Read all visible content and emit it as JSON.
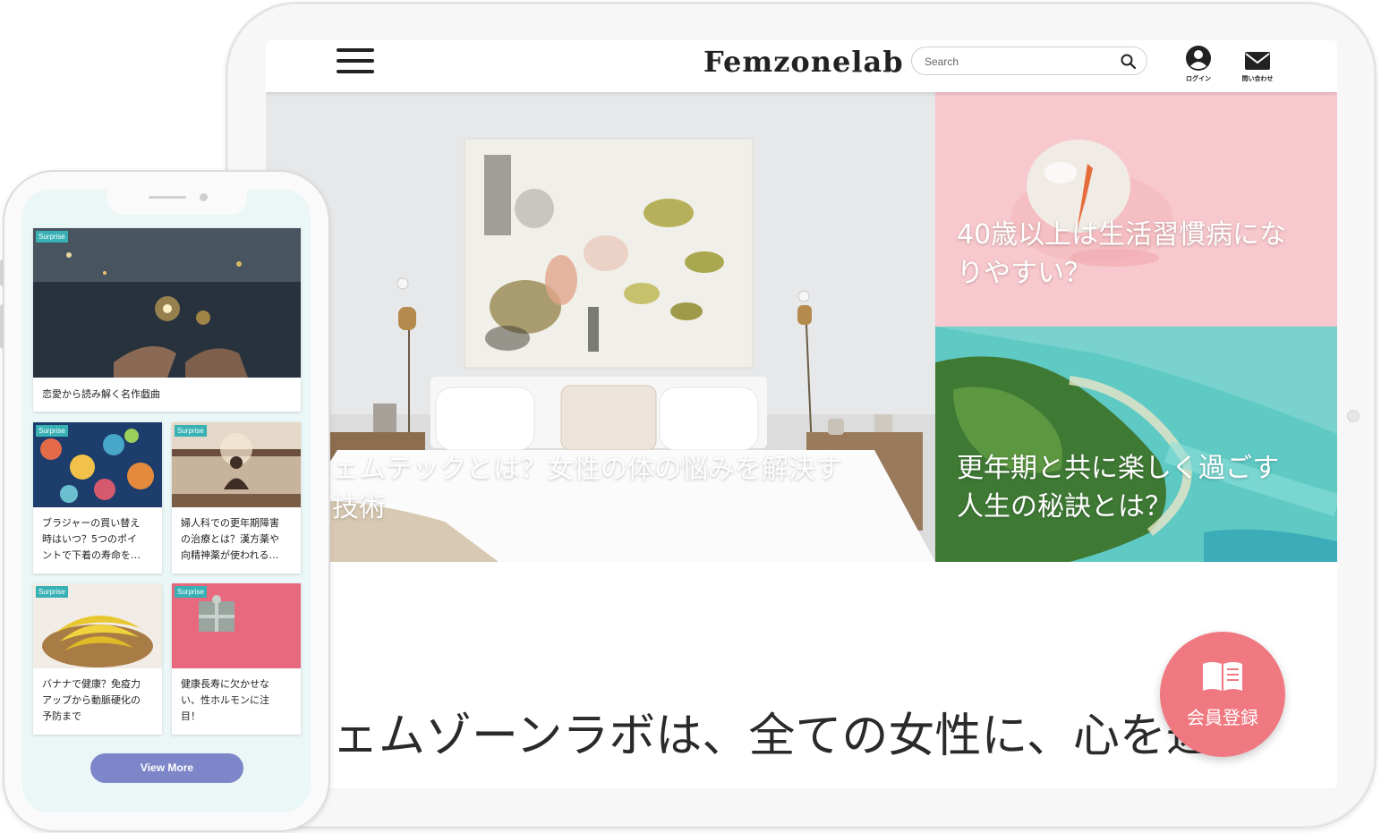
{
  "tablet": {
    "logo": "Femzonelab",
    "search_placeholder": "Search",
    "login_label": "ログイン",
    "contact_label": "問い合わせ",
    "hero_main_line1": "ェムテックとは？女性の体の悩みを解決す",
    "hero_main_line2": "技術",
    "hero_right_top_line1": "40歳以上は生活習慣病にな",
    "hero_right_top_line2": "りやすい？",
    "hero_right_bottom_line1": "更年期と共に楽しく過ごす",
    "hero_right_bottom_line2": "人生の秘訣とは？",
    "tagline": "ェムゾーンラボは、全ての女性に、心を込め",
    "member_button": "会員登録"
  },
  "phone": {
    "cards": [
      {
        "badge": "Surprise",
        "title": "恋愛から読み解く名作戯曲"
      },
      {
        "badge": "Surprise",
        "title_lines": [
          "ブラジャーの買い替え",
          "時はいつ？5つのポイ",
          "ントで下着の寿命を…"
        ]
      },
      {
        "badge": "Surprise",
        "title_lines": [
          "婦人科での更年期障害",
          "の治療とは？漢方薬や",
          "向精神薬が使われる…"
        ]
      },
      {
        "badge": "Surprise",
        "title_lines": [
          "バナナで健康？免疫力",
          "アップから動脈硬化の",
          "予防まで"
        ]
      },
      {
        "badge": "Surprise",
        "title_lines": [
          "健康長寿に欠かせな",
          "い、性ホルモンに注",
          "目！"
        ]
      }
    ],
    "view_more": "View More"
  },
  "colors": {
    "member_button": "#f07881",
    "badge": "#38b1b5",
    "view_more": "#7d86c8",
    "phone_bg": "#ebf6f6"
  }
}
